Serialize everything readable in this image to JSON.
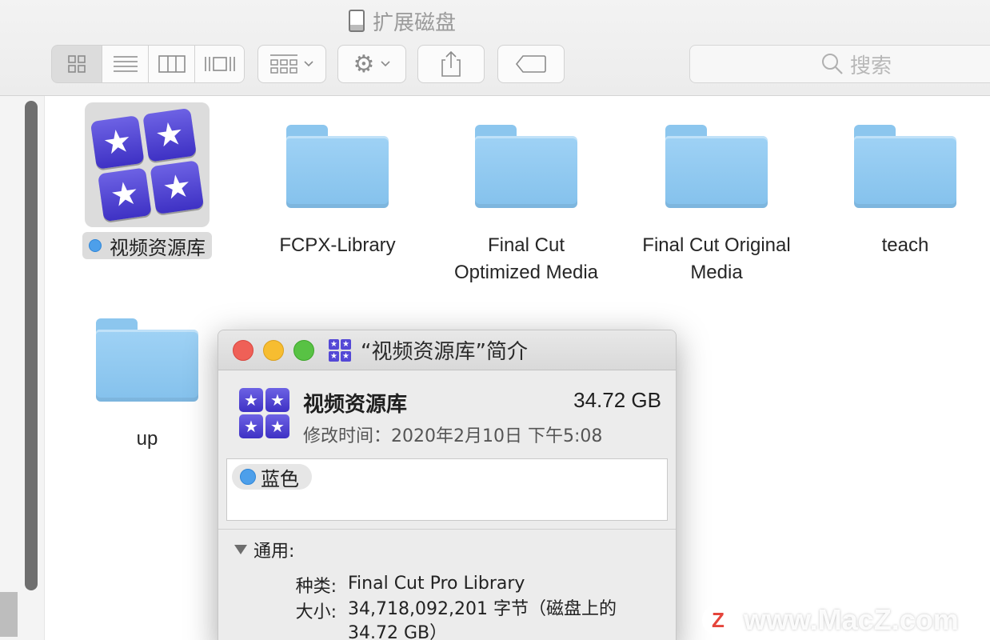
{
  "window": {
    "title": "扩展磁盘",
    "search_placeholder": "搜索"
  },
  "toolbar": {
    "view_buttons": [
      "icon-view",
      "list-view",
      "column-view",
      "gallery-view"
    ],
    "active_view": "icon-view",
    "group_button": "group-icon",
    "action_button": "gear-icon",
    "share_button": "share-icon",
    "tag_button": "tag-icon"
  },
  "files": [
    {
      "label": "视频资源库",
      "type": "app",
      "selected": true,
      "tag_color": "#4d9fea"
    },
    {
      "label": "FCPX-Library",
      "type": "folder"
    },
    {
      "label": "Final Cut Optimized Media",
      "line1": "Final Cut",
      "line2": "Optimized Media",
      "type": "folder"
    },
    {
      "label": "Final Cut Original Media",
      "line1": "Final Cut Original",
      "line2": "Media",
      "type": "folder"
    },
    {
      "label": "teach",
      "type": "folder"
    },
    {
      "label": "up",
      "type": "folder"
    }
  ],
  "info_window": {
    "title": "“视频资源库”简介",
    "name": "视频资源库",
    "size": "34.72 GB",
    "modified": "修改时间：2020年2月10日 下午5:08",
    "tag": "蓝色",
    "section_general": "通用:",
    "kind_label": "种类:",
    "kind_value": "Final Cut Pro Library",
    "size_label": "大小:",
    "size_value": "34,718,092,201 字节（磁盘上的 34.72 GB）"
  },
  "watermark": {
    "badge": "Z",
    "text": "www.MacZ.com"
  },
  "colors": {
    "folder": "#8cc6ee",
    "tag_blue": "#4d9fea",
    "close": "#ef6057",
    "minimize": "#f7bd30",
    "zoom": "#58c244"
  }
}
